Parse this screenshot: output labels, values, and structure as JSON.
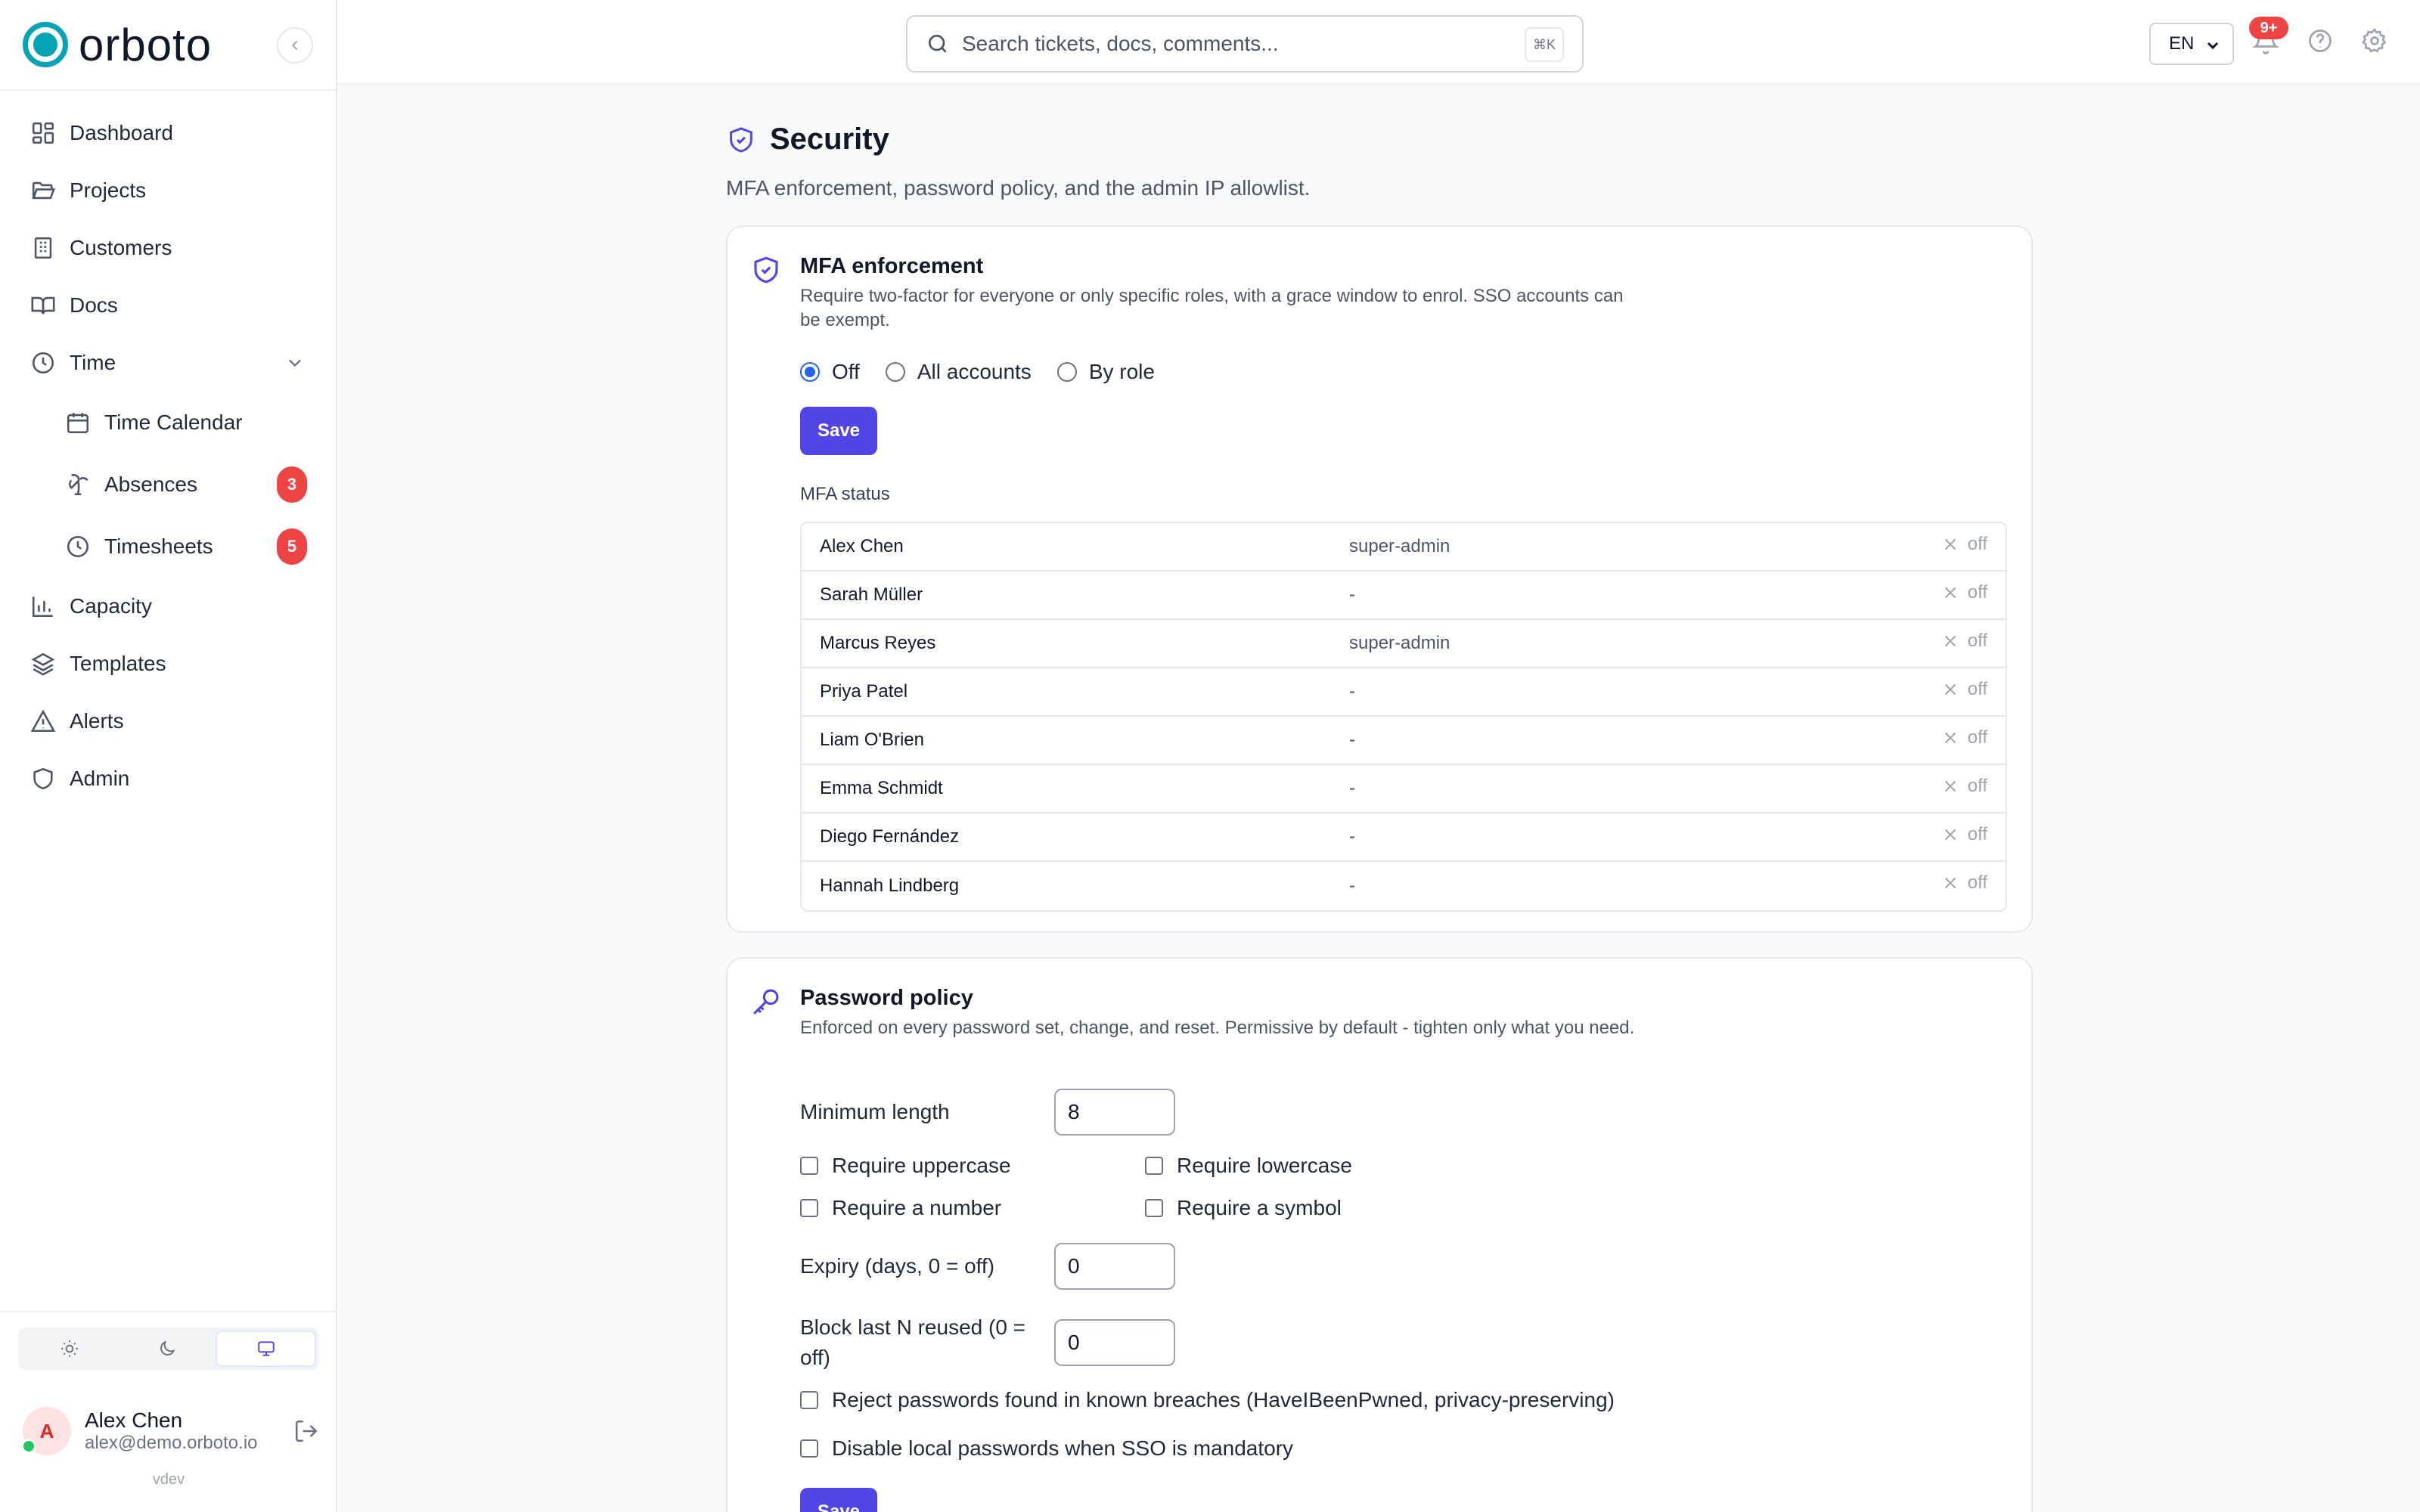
{
  "brand": {
    "name": "orboto"
  },
  "sidebar": {
    "items": [
      {
        "label": "Dashboard"
      },
      {
        "label": "Projects"
      },
      {
        "label": "Customers"
      },
      {
        "label": "Docs"
      },
      {
        "label": "Time"
      },
      {
        "label": "Time Calendar"
      },
      {
        "label": "Absences",
        "badge": "3"
      },
      {
        "label": "Timesheets",
        "badge": "5"
      },
      {
        "label": "Capacity"
      },
      {
        "label": "Templates"
      },
      {
        "label": "Alerts"
      },
      {
        "label": "Admin"
      }
    ]
  },
  "user": {
    "initial": "A",
    "name": "Alex Chen",
    "email": "alex@demo.orboto.io",
    "version": "vdev"
  },
  "topbar": {
    "search_placeholder": "Search tickets, docs, comments...",
    "shortcut": "⌘K",
    "language": "EN",
    "notifications": "9+"
  },
  "page": {
    "title": "Security",
    "subtitle": "MFA enforcement, password policy, and the admin IP allowlist."
  },
  "mfa": {
    "title": "MFA enforcement",
    "description": "Require two-factor for everyone or only specific roles, with a grace window to enrol. SSO accounts can be exempt.",
    "options": [
      "Off",
      "All accounts",
      "By role"
    ],
    "selected": "Off",
    "save_label": "Save",
    "status_label": "MFA status",
    "rows": [
      {
        "name": "Alex Chen",
        "role": "super-admin",
        "status": "off"
      },
      {
        "name": "Sarah Müller",
        "role": "-",
        "status": "off"
      },
      {
        "name": "Marcus Reyes",
        "role": "super-admin",
        "status": "off"
      },
      {
        "name": "Priya Patel",
        "role": "-",
        "status": "off"
      },
      {
        "name": "Liam O'Brien",
        "role": "-",
        "status": "off"
      },
      {
        "name": "Emma Schmidt",
        "role": "-",
        "status": "off"
      },
      {
        "name": "Diego Fernández",
        "role": "-",
        "status": "off"
      },
      {
        "name": "Hannah Lindberg",
        "role": "-",
        "status": "off"
      }
    ]
  },
  "password": {
    "title": "Password policy",
    "description": "Enforced on every password set, change, and reset. Permissive by default - tighten only what you need.",
    "min_length_label": "Minimum length",
    "min_length": "8",
    "require_uppercase": "Require uppercase",
    "require_lowercase": "Require lowercase",
    "require_number": "Require a number",
    "require_symbol": "Require a symbol",
    "expiry_label": "Expiry (days, 0 = off)",
    "expiry": "0",
    "reuse_label": "Block last N reused (0 = off)",
    "reuse": "0",
    "breach_label": "Reject passwords found in known breaches (HaveIBeenPwned, privacy-preserving)",
    "sso_label": "Disable local passwords when SSO is mandatory",
    "save_label": "Save"
  },
  "colors": {
    "accent": "#4f46e5",
    "brand": "#06a3b5",
    "badge": "#ef4444"
  }
}
